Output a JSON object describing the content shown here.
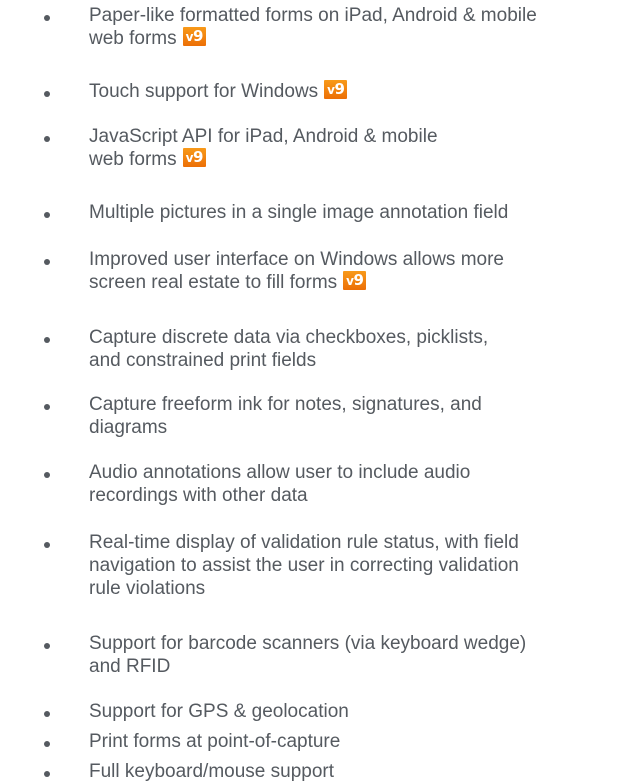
{
  "badge": {
    "prefix": "v",
    "number": "9",
    "color": "#F28A10"
  },
  "features": [
    {
      "lines": [
        "Paper-like formatted forms on iPad, Android & mobile",
        "web forms"
      ],
      "badge": true
    },
    {
      "lines": [
        "Touch support for Windows"
      ],
      "badge": true
    },
    {
      "lines": [
        "JavaScript API for iPad, Android & mobile",
        "web forms"
      ],
      "badge": true
    },
    {
      "lines": [
        "Multiple pictures in a single image annotation field"
      ],
      "badge": false
    },
    {
      "lines": [
        "Improved user interface on Windows allows more",
        "screen real estate to fill forms"
      ],
      "badge": true
    },
    {
      "lines": [
        "Capture discrete data via checkboxes, picklists,",
        "and constrained print fields"
      ],
      "badge": false
    },
    {
      "lines": [
        "Capture freeform ink for notes, signatures, and",
        "diagrams"
      ],
      "badge": false
    },
    {
      "lines": [
        "Audio annotations allow user to include audio",
        "recordings with other data"
      ],
      "badge": false
    },
    {
      "lines": [
        "Real-time display of validation rule status, with field",
        "navigation to assist the user in correcting validation",
        "rule violations"
      ],
      "badge": false
    },
    {
      "lines": [
        "Support for barcode scanners (via keyboard wedge)",
        "and RFID"
      ],
      "badge": false
    },
    {
      "lines": [
        "Support for GPS & geolocation"
      ],
      "badge": false
    },
    {
      "lines": [
        "Print forms at point-of-capture"
      ],
      "badge": false
    },
    {
      "lines": [
        "Full keyboard/mouse support"
      ],
      "badge": false
    }
  ]
}
